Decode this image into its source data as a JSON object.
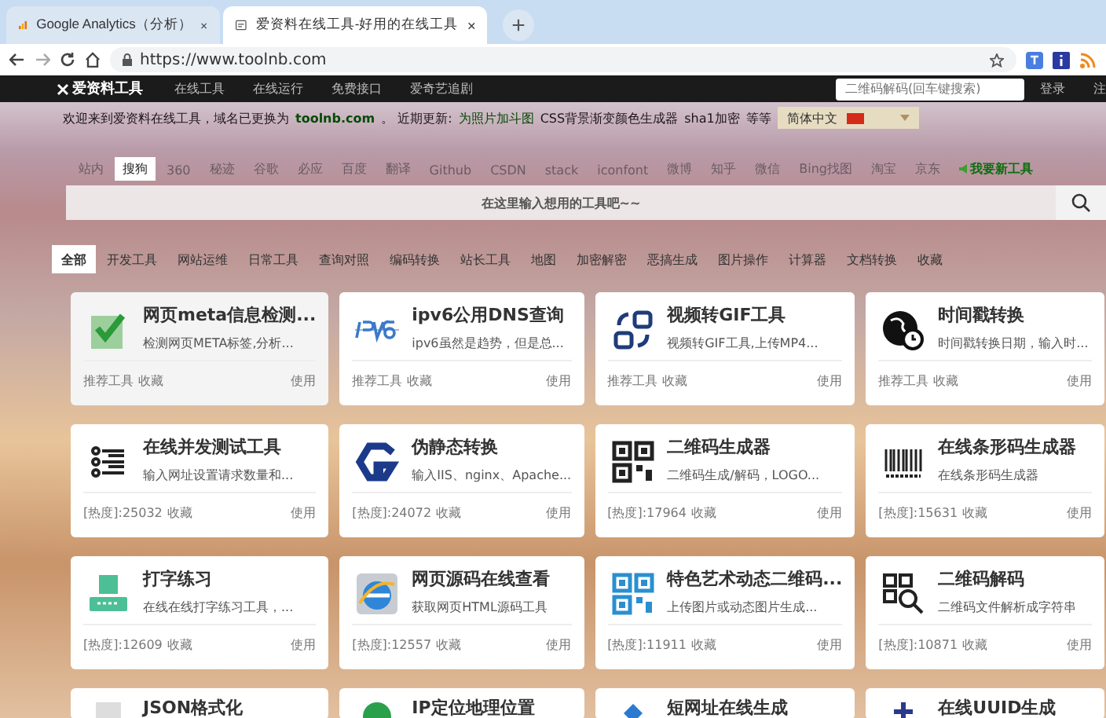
{
  "browser": {
    "tabs": [
      {
        "title": "Google Analytics（分析）",
        "kind": "bars",
        "selected": false
      },
      {
        "title": "爱资料在线工具-好用的在线工具",
        "kind": "page",
        "selected": true
      }
    ],
    "new_tab": "+",
    "url": "https://www.toolnb.com"
  },
  "nav": {
    "logo": "爱资料工具",
    "links": [
      "在线工具",
      "在线运行",
      "免费接口",
      "爱奇艺追剧"
    ],
    "search_placeholder": "二维码解码(回车键搜索)",
    "login": "登录",
    "register": "注"
  },
  "notice": {
    "text": "欢迎来到爱资料在线工具，域名已更换为",
    "domain": "toolnb.com",
    "after": "。 近期更新:",
    "updates": [
      {
        "text": "为照片加斗图",
        "highlight": true
      },
      {
        "text": "CSS背景渐变颜色生成器",
        "highlight": false
      },
      {
        "text": "sha1加密",
        "highlight": false
      },
      {
        "text": "等等",
        "highlight": false
      }
    ],
    "language": "简体中文"
  },
  "engines": [
    {
      "label": "站内",
      "selected": false
    },
    {
      "label": "搜狗",
      "selected": true
    },
    {
      "label": "360",
      "selected": false
    },
    {
      "label": "秘迹",
      "selected": false
    },
    {
      "label": "谷歌",
      "selected": false
    },
    {
      "label": "必应",
      "selected": false
    },
    {
      "label": "百度",
      "selected": false
    },
    {
      "label": "翻译",
      "selected": false
    },
    {
      "label": "Github",
      "selected": false
    },
    {
      "label": "CSDN",
      "selected": false
    },
    {
      "label": "stack",
      "selected": false
    },
    {
      "label": "iconfont",
      "selected": false
    },
    {
      "label": "微博",
      "selected": false
    },
    {
      "label": "知乎",
      "selected": false
    },
    {
      "label": "微信",
      "selected": false
    },
    {
      "label": "Bing找图",
      "selected": false
    },
    {
      "label": "淘宝",
      "selected": false
    },
    {
      "label": "京东",
      "selected": false
    }
  ],
  "request_tool": "我要新工具",
  "search": {
    "placeholder": "在这里输入想用的工具吧~~"
  },
  "categories": [
    {
      "label": "全部",
      "selected": true
    },
    {
      "label": "开发工具",
      "selected": false
    },
    {
      "label": "网站运维",
      "selected": false
    },
    {
      "label": "日常工具",
      "selected": false
    },
    {
      "label": "查询对照",
      "selected": false
    },
    {
      "label": "编码转换",
      "selected": false
    },
    {
      "label": "站长工具",
      "selected": false
    },
    {
      "label": "地图",
      "selected": false
    },
    {
      "label": "加密解密",
      "selected": false
    },
    {
      "label": "恶搞生成",
      "selected": false
    },
    {
      "label": "图片操作",
      "selected": false
    },
    {
      "label": "计算器",
      "selected": false
    },
    {
      "label": "文档转换",
      "selected": false
    },
    {
      "label": "收藏",
      "selected": false
    }
  ],
  "tools": [
    {
      "kind": "check",
      "title": "网页meta信息检测...",
      "desc": "检测网页META标签,分析...",
      "footer": "推荐工具",
      "favorite": "收藏",
      "use": "使用"
    },
    {
      "kind": "ipv6",
      "title": "ipv6公用DNS查询",
      "desc": "ipv6虽然是趋势，但是总...",
      "footer": "推荐工具",
      "favorite": "收藏",
      "use": "使用"
    },
    {
      "kind": "convert",
      "title": "视频转GIF工具",
      "desc": "视频转GIF工具,上传MP4...",
      "footer": "推荐工具",
      "favorite": "收藏",
      "use": "使用"
    },
    {
      "kind": "globe",
      "title": "时间戳转换",
      "desc": "时间戳转换日期，输入时...",
      "footer": "推荐工具",
      "favorite": "收藏",
      "use": "使用"
    },
    {
      "kind": "list",
      "title": "在线并发测试工具",
      "desc": "输入网址设置请求数量和...",
      "footer": "[热度]:25032",
      "favorite": "收藏",
      "use": "使用"
    },
    {
      "kind": "g",
      "title": "伪静态转换",
      "desc": "输入IIS、nginx、Apache...",
      "footer": "[热度]:24072",
      "favorite": "收藏",
      "use": "使用"
    },
    {
      "kind": "qr",
      "title": "二维码生成器",
      "desc": "二维码生成/解码，LOGO...",
      "footer": "[热度]:17964",
      "favorite": "收藏",
      "use": "使用"
    },
    {
      "kind": "barcode",
      "title": "在线条形码生成器",
      "desc": "在线条形码生成器",
      "footer": "[热度]:15631",
      "favorite": "收藏",
      "use": "使用"
    },
    {
      "kind": "printer",
      "title": "打字练习",
      "desc": "在线在线打字练习工具，...",
      "footer": "[热度]:12609",
      "favorite": "收藏",
      "use": "使用"
    },
    {
      "kind": "browser",
      "title": "网页源码在线查看",
      "desc": "获取网页HTML源码工具",
      "footer": "[热度]:12557",
      "favorite": "收藏",
      "use": "使用"
    },
    {
      "kind": "qrblue",
      "title": "特色艺术动态二维码...",
      "desc": "上传图片或动态图片生成...",
      "footer": "[热度]:11911",
      "favorite": "收藏",
      "use": "使用"
    },
    {
      "kind": "qrsearch",
      "title": "二维码解码",
      "desc": "二维码文件解析成字符串",
      "footer": "[热度]:10871",
      "favorite": "收藏",
      "use": "使用"
    },
    {
      "kind": "doc",
      "title": "JSON格式化"
    },
    {
      "kind": "pin",
      "title": "IP定位地理位置"
    },
    {
      "kind": "diamond",
      "title": "短网址在线生成"
    },
    {
      "kind": "cross",
      "title": "在线UUID生成"
    }
  ]
}
